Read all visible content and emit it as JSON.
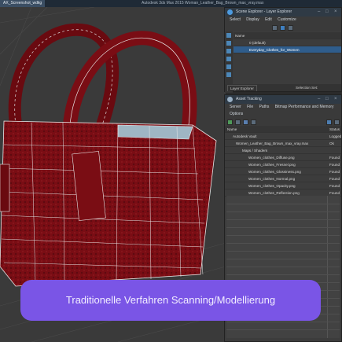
{
  "window": {
    "tab_label": "AX_Screenshot_wdkg",
    "app_title": "Autodesk 3ds Max 2015   Woman_Leather_Bag_Brown_max_vray.max"
  },
  "scene_explorer": {
    "title": "Scene Explorer - Layer Explorer",
    "menu": [
      "Select",
      "Display",
      "Edit",
      "Customize"
    ],
    "column_header": "Name",
    "rows": [
      "0 (default)",
      "Everyday_Clothes_for_Women"
    ],
    "footer_left": "Layer Explorer",
    "footer_right": "Selection Set:"
  },
  "asset_tracking": {
    "title": "Asset Tracking",
    "menu": [
      "Server",
      "File",
      "Paths",
      "Bitmap Performance and Memory"
    ],
    "menu2": "Options",
    "col_name": "Name",
    "col_status": "Status",
    "rows": [
      {
        "name": "Autodesk Vault",
        "status": "Logged"
      },
      {
        "name": "Women_Leather_Bag_Brown_max_vray.max",
        "status": "Ok"
      },
      {
        "name": "Maps / Shaders",
        "status": ""
      },
      {
        "name": "Women_clothes_Diffuse.png",
        "status": "Found"
      },
      {
        "name": "Women_clothes_Fresnel.png",
        "status": "Found"
      },
      {
        "name": "Women_clothes_Glossiness.png",
        "status": "Found"
      },
      {
        "name": "Women_clothes_Normal.png",
        "status": "Found"
      },
      {
        "name": "Women_clothes_Opacity.png",
        "status": "Found"
      },
      {
        "name": "Women_clothes_Reflection.png",
        "status": "Found"
      }
    ]
  },
  "banner": {
    "text": "Traditionelle Verfahren Scanning/Modellierung"
  },
  "colors": {
    "bag_red": "#7a0d14",
    "wire": "#e8e8e8",
    "banner": "#7a55e6",
    "selection": "#2f5d8c"
  }
}
